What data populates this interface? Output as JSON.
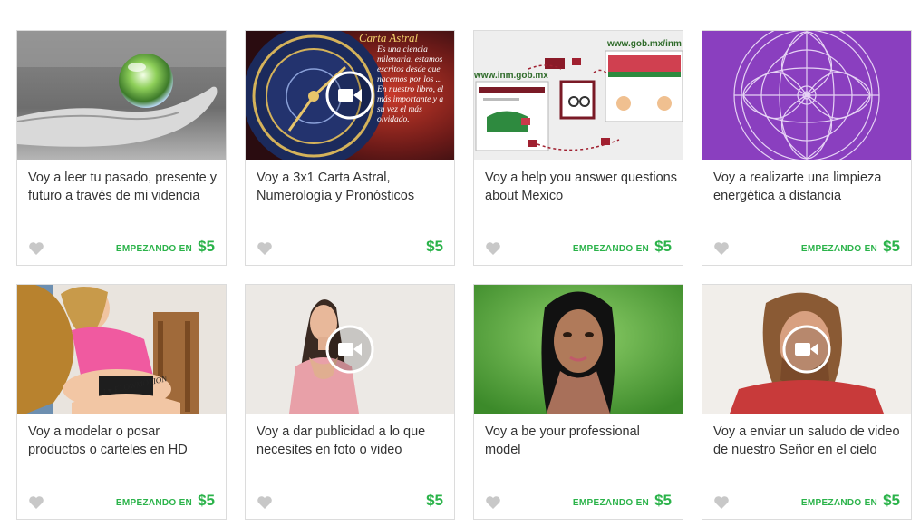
{
  "gigs": [
    {
      "title": "Voy a leer tu pasado, presente y futuro a través de mi videncia",
      "starting_label": "EMPEZANDO EN",
      "price": "$5",
      "image": "hand-holding-crystal-ball",
      "has_video": false
    },
    {
      "title": "Voy a 3x1 Carta Astral, Numerología y Pronósticos",
      "starting_label": "",
      "price": "$5",
      "image": "astrology-clock",
      "has_video": true,
      "image_text": {
        "heading": "Carta Astral",
        "body": "Es una ciencia milenaria, estamos escritos desde que nacemos por los ... En nuestro libro, el más importante y a su vez el más olvidado."
      }
    },
    {
      "title": "Voy a help you answer questions about Mexico",
      "starting_label": "EMPEZANDO EN",
      "price": "$5",
      "image": "government-websites",
      "has_video": false,
      "image_text": {
        "left": "www.inm.gob.mx",
        "right": "www.gob.mx/inm"
      }
    },
    {
      "title": "Voy a realizarte una limpieza energética a distancia",
      "starting_label": "EMPEZANDO EN",
      "price": "$5",
      "image": "purple-mandala",
      "has_video": false
    },
    {
      "title": "Voy a modelar o posar productos o carteles en HD",
      "starting_label": "EMPEZANDO EN",
      "price": "$5",
      "image": "model-with-sign",
      "has_video": false,
      "image_text": {
        "sign": "I ♥ FLOWMOTION"
      }
    },
    {
      "title": "Voy a dar publicidad a lo que necesites en foto o video",
      "starting_label": "",
      "price": "$5",
      "image": "woman-video",
      "has_video": true
    },
    {
      "title": "Voy a be your professional model",
      "starting_label": "EMPEZANDO EN",
      "price": "$5",
      "image": "woman-green-background",
      "has_video": false
    },
    {
      "title": "Voy a enviar un saludo de video de nuestro Señor en el cielo",
      "starting_label": "EMPEZANDO EN",
      "price": "$5",
      "image": "man-video",
      "has_video": true
    }
  ],
  "colors": {
    "price": "#2bb34a",
    "heart": "#c8c8c8",
    "border": "#dcdcdc",
    "text": "#333333"
  }
}
